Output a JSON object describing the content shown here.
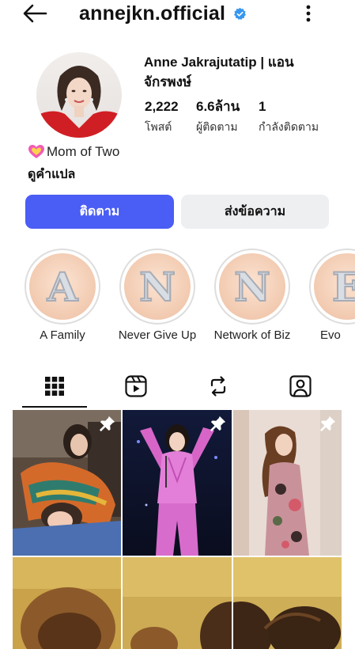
{
  "header": {
    "username": "annejkn.official",
    "back_icon": "arrow-left-icon",
    "verified_icon": "verified-badge-icon",
    "more_icon": "more-vertical-icon",
    "verified_color": "#3797f0"
  },
  "profile": {
    "display_name": "Anne Jakrajutatip | แอน จักรพงษ์",
    "stats": [
      {
        "value": "2,222",
        "label": "โพสต์"
      },
      {
        "value": "6.6ล้าน",
        "label": "ผู้ติดตาม"
      },
      {
        "value": "1",
        "label": "กำลังติดตาม"
      }
    ],
    "bio": "Mom of Two",
    "bio_icon": "sparkling-heart-icon",
    "translate_label": "ดูคำแปล"
  },
  "actions": {
    "follow_label": "ติดตาม",
    "message_label": "ส่งข้อความ",
    "follow_color": "#4a5df5",
    "message_color": "#eeeff1"
  },
  "highlights": [
    {
      "letter": "A",
      "label": "A Family"
    },
    {
      "letter": "N",
      "label": "Never Give Up"
    },
    {
      "letter": "N",
      "label": "Network of Biz"
    },
    {
      "letter": "E",
      "label": "Evo"
    }
  ],
  "tabs": [
    {
      "name": "posts-grid-icon",
      "active": true
    },
    {
      "name": "reels-icon",
      "active": false
    },
    {
      "name": "reposts-icon",
      "active": false
    },
    {
      "name": "tagged-icon",
      "active": false
    }
  ],
  "posts": [
    {
      "pinned": true,
      "icon": "pin-icon"
    },
    {
      "pinned": true,
      "icon": "pin-icon"
    },
    {
      "pinned": true,
      "icon": "pin-icon"
    },
    {
      "pinned": false
    },
    {
      "pinned": false
    },
    {
      "pinned": false
    }
  ]
}
